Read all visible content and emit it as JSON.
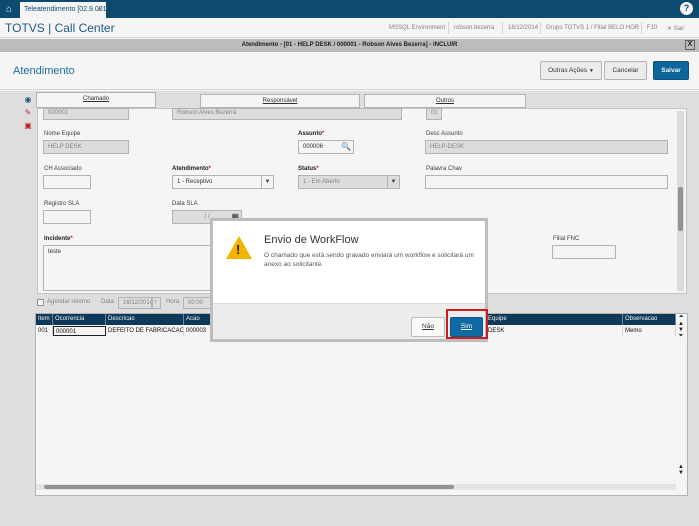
{
  "topbar": {
    "tab_label": "Teleatendimento [02.9.0013]",
    "tab_close": "×",
    "help": "?"
  },
  "titlebar": {
    "app_title": "TOTVS | Call Center",
    "environment": "MSSQL Environment",
    "user": "robson.bezerra",
    "date": "16/12/2014",
    "branch": "Grupo TOTVS 1 / Filial BELO HOR",
    "key": "F10",
    "exit": "Sair"
  },
  "window": {
    "title": "Atendimento - [01 - HELP DESK / 000001 - Robson Alves Bezerra] - INCLUIR",
    "close": "X"
  },
  "page": {
    "title": "Atendimento",
    "other_actions": "Outras Ações",
    "cancel": "Cancelar",
    "save": "Salvar"
  },
  "tabs": [
    "Chamado",
    "Responsável",
    "Outros"
  ],
  "form": {
    "row0": {
      "v1": "000001",
      "v2": "Robson Alves Bezerra",
      "v3": "01"
    },
    "nome_equipe_label": "Nome Equipe",
    "nome_equipe": "HELP DESK",
    "assunto_label": "Assunto",
    "assunto": "000006",
    "desc_assunto_label": "Desc Assunto",
    "desc_assunto": "HELP-DESK",
    "ch_associado_label": "CH Associado",
    "atendimento_label": "Atendimento",
    "atendimento": "1 - Receptivo",
    "status_label": "Status",
    "status": "1 - Em Aberto",
    "palavra_chav_label": "Palavra Chav",
    "registro_sla_label": "Registro SLA",
    "data_sla_label": "Data SLA",
    "data_sla": "/ /",
    "incidente_label": "Incidente",
    "incidente": "teste",
    "filial_fnc_label": "Filial FNC",
    "required_mark": "*"
  },
  "schedule": {
    "agendar_label": "Agendar retorno",
    "data_label": "Data:",
    "data": "16/12/2014",
    "hora_label": "Hora:",
    "hora": "00:00"
  },
  "grid": {
    "headers": [
      "Item",
      "Ocorrencia",
      "Descricao",
      "Acao",
      "Equipe",
      "Observacao"
    ],
    "row": [
      "001",
      "000001",
      "DEFEITO DE FABRICACAO",
      "000003",
      "DESK",
      "Memo"
    ]
  },
  "dialog": {
    "title": "Envio de WorkFlow",
    "message": "O chamado que está sendo gravado enviará um workflow e solicitará um anexo ao solicitante.",
    "no": "Não",
    "yes": "Sim",
    "icon_glyph": "!"
  },
  "colors": {
    "header_blue": "#0d4e75",
    "primary": "#0f6aa3",
    "highlight": "#c81e1e",
    "warning": "#f2b400"
  }
}
